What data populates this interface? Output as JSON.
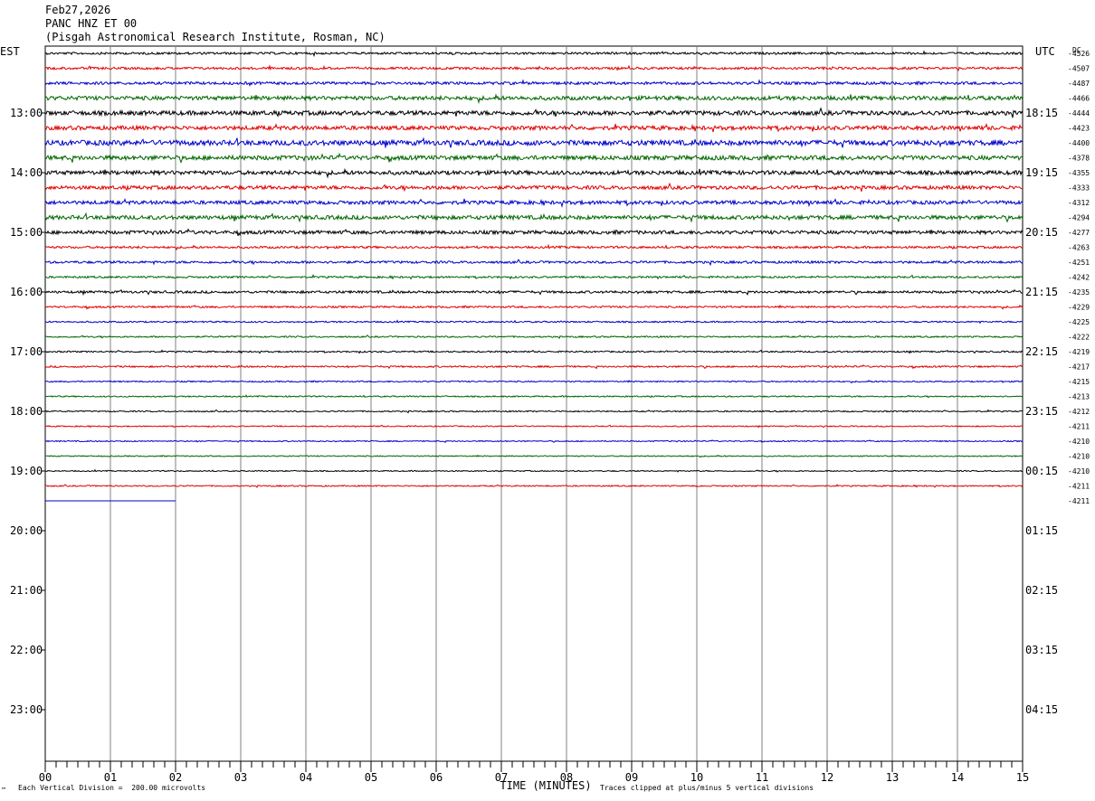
{
  "header": {
    "date": "Feb27,2026",
    "station": "PANC HNZ ET 00",
    "location": "(Pisgah Astronomical Research Institute, Rosman, NC)"
  },
  "axes": {
    "left_tz": "EST",
    "right_tz": "UTC",
    "dc_label": "DC",
    "xlabel": "TIME (MINUTES)"
  },
  "notes": {
    "division": "Each Vertical Division =  200.00 microvolts",
    "clipped": "Traces clipped at plus/minus 5 vertical divisions",
    "corner_mark": "™"
  },
  "colors": {
    "trace_cycle": [
      "#000000",
      "#e00000",
      "#0000cc",
      "#006600"
    ],
    "grid": "#808080"
  },
  "chart_data": {
    "type": "line",
    "title": "PANC HNZ ET 00",
    "x_range_minutes": [
      0,
      15
    ],
    "x_ticks": [
      "00",
      "01",
      "02",
      "03",
      "04",
      "05",
      "06",
      "07",
      "08",
      "09",
      "10",
      "11",
      "12",
      "13",
      "14",
      "15"
    ],
    "row_minutes": 15,
    "left_labels": [
      "13:00",
      "14:00",
      "15:00",
      "16:00",
      "17:00",
      "18:00",
      "19:00",
      "20:00",
      "21:00",
      "22:00",
      "23:00"
    ],
    "right_labels": [
      "18:15",
      "19:15",
      "20:15",
      "21:15",
      "22:15",
      "23:15",
      "00:15",
      "01:15",
      "02:15",
      "03:15",
      "04:15"
    ],
    "dc_offsets": [
      "-4526",
      "-4507",
      "-4487",
      "-4466",
      "-4444",
      "-4423",
      "-4400",
      "-4378",
      "-4355",
      "-4333",
      "-4312",
      "-4294",
      "-4277",
      "-4263",
      "-4251",
      "-4242",
      "-4235",
      "-4229",
      "-4225",
      "-4222",
      "-4219",
      "-4217",
      "-4215",
      "-4213",
      "-4212",
      "-4211",
      "-4210",
      "-4210",
      "-4210",
      "-4211",
      "-4211"
    ],
    "traces": [
      {
        "index": 0,
        "color": "#000000",
        "amplitude": 1.2,
        "end_minute": 15
      },
      {
        "index": 1,
        "color": "#e00000",
        "amplitude": 1.3,
        "end_minute": 15
      },
      {
        "index": 2,
        "color": "#0000cc",
        "amplitude": 1.5,
        "end_minute": 15
      },
      {
        "index": 3,
        "color": "#006600",
        "amplitude": 2.2,
        "end_minute": 15
      },
      {
        "index": 4,
        "color": "#000000",
        "amplitude": 2.4,
        "end_minute": 15
      },
      {
        "index": 5,
        "color": "#e00000",
        "amplitude": 2.2,
        "end_minute": 15
      },
      {
        "index": 6,
        "color": "#0000cc",
        "amplitude": 2.8,
        "end_minute": 15
      },
      {
        "index": 7,
        "color": "#006600",
        "amplitude": 2.4,
        "end_minute": 15
      },
      {
        "index": 8,
        "color": "#000000",
        "amplitude": 2.2,
        "end_minute": 15
      },
      {
        "index": 9,
        "color": "#e00000",
        "amplitude": 2.0,
        "end_minute": 15
      },
      {
        "index": 10,
        "color": "#0000cc",
        "amplitude": 2.0,
        "end_minute": 15
      },
      {
        "index": 11,
        "color": "#006600",
        "amplitude": 2.2,
        "end_minute": 15
      },
      {
        "index": 12,
        "color": "#000000",
        "amplitude": 1.9,
        "end_minute": 15
      },
      {
        "index": 13,
        "color": "#e00000",
        "amplitude": 1.2,
        "end_minute": 15
      },
      {
        "index": 14,
        "color": "#0000cc",
        "amplitude": 1.3,
        "end_minute": 15
      },
      {
        "index": 15,
        "color": "#006600",
        "amplitude": 1.0,
        "end_minute": 15
      },
      {
        "index": 16,
        "color": "#000000",
        "amplitude": 1.3,
        "end_minute": 15
      },
      {
        "index": 17,
        "color": "#e00000",
        "amplitude": 1.0,
        "end_minute": 15
      },
      {
        "index": 18,
        "color": "#0000cc",
        "amplitude": 0.8,
        "end_minute": 15
      },
      {
        "index": 19,
        "color": "#006600",
        "amplitude": 0.8,
        "end_minute": 15
      },
      {
        "index": 20,
        "color": "#000000",
        "amplitude": 0.8,
        "end_minute": 15
      },
      {
        "index": 21,
        "color": "#e00000",
        "amplitude": 0.9,
        "end_minute": 15
      },
      {
        "index": 22,
        "color": "#0000cc",
        "amplitude": 0.7,
        "end_minute": 15
      },
      {
        "index": 23,
        "color": "#006600",
        "amplitude": 0.7,
        "end_minute": 15
      },
      {
        "index": 24,
        "color": "#000000",
        "amplitude": 0.7,
        "end_minute": 15
      },
      {
        "index": 25,
        "color": "#e00000",
        "amplitude": 0.6,
        "end_minute": 15
      },
      {
        "index": 26,
        "color": "#0000cc",
        "amplitude": 0.6,
        "end_minute": 15
      },
      {
        "index": 27,
        "color": "#006600",
        "amplitude": 0.6,
        "end_minute": 15
      },
      {
        "index": 28,
        "color": "#000000",
        "amplitude": 0.6,
        "end_minute": 15
      },
      {
        "index": 29,
        "color": "#e00000",
        "amplitude": 0.7,
        "end_minute": 15
      },
      {
        "index": 30,
        "color": "#0000cc",
        "amplitude": 0.0,
        "end_minute": 2
      }
    ]
  }
}
